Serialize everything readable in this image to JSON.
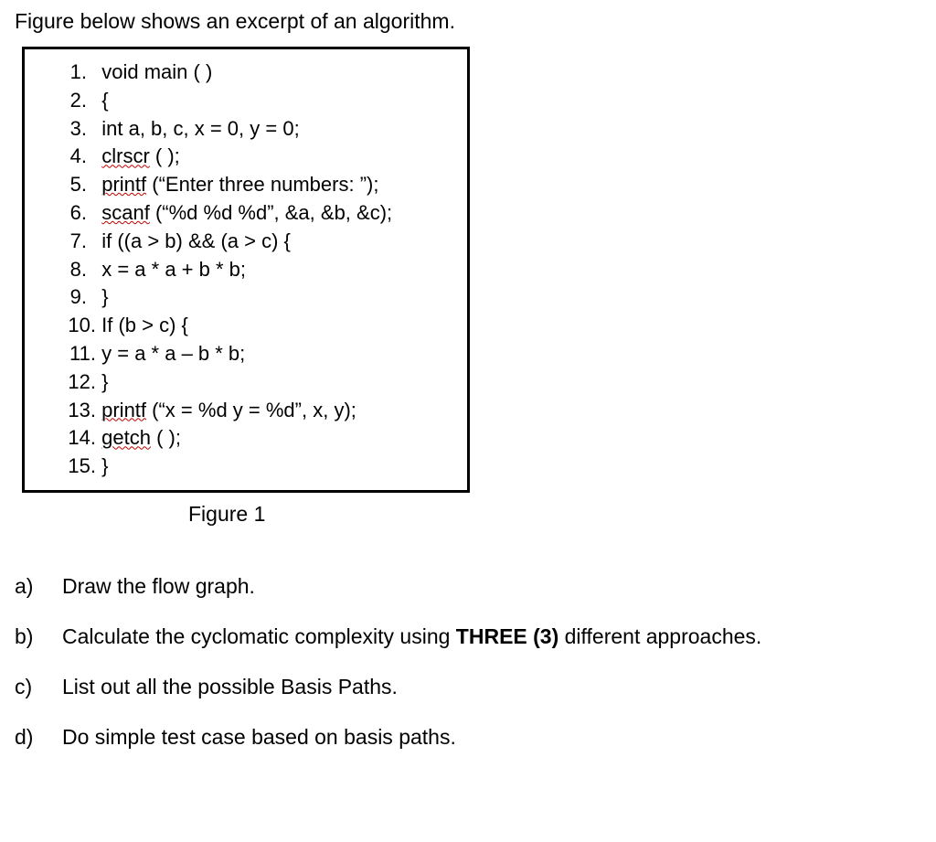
{
  "intro": "Figure below shows an excerpt of an algorithm.",
  "code": {
    "lines": [
      {
        "num": "1.",
        "pre": "void main ( )"
      },
      {
        "num": "2.",
        "pre": "{"
      },
      {
        "num": "3.",
        "pre": "int a, b, c, x = 0, y = 0;"
      },
      {
        "num": "4.",
        "sq": "clrscr",
        "post": " ( );"
      },
      {
        "num": "5.",
        "sq": "printf",
        "post": " (“Enter three numbers: ”);"
      },
      {
        "num": "6.",
        "sq": "scanf",
        "post": " (“%d %d %d”, &a, &b, &c);"
      },
      {
        "num": "7.",
        "pre": "if ((a > b) && (a > c) {"
      },
      {
        "num": "8.",
        "pre": "x = a * a + b * b;"
      },
      {
        "num": "9.",
        "pre": "}"
      },
      {
        "num": "10.",
        "pre": "If (b > c) {"
      },
      {
        "num": "11.",
        "pre": "y = a * a – b * b;"
      },
      {
        "num": "12.",
        "pre": "}"
      },
      {
        "num": "13.",
        "sq": "printf",
        "post": " (“x = %d y = %d”, x, y);"
      },
      {
        "num": "14.",
        "sq": "getch",
        "post": " ( );"
      },
      {
        "num": "15.",
        "pre": "}"
      }
    ]
  },
  "figure_label": "Figure 1",
  "questions": [
    {
      "letter": "a)",
      "text": "Draw the flow graph."
    },
    {
      "letter": "b)",
      "pre": "Calculate the cyclomatic complexity using ",
      "bold": "THREE (3)",
      "post": " different approaches."
    },
    {
      "letter": "c)",
      "text": "List out all the possible Basis Paths."
    },
    {
      "letter": "d)",
      "text": "Do simple test case based on basis paths."
    }
  ]
}
